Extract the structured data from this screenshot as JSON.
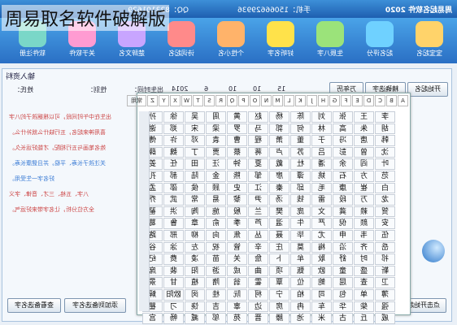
{
  "overlay_title": "周易取名软件破解版",
  "window": {
    "title": "周易起名软件 2020",
    "qq": "QQ：823101629",
    "phone": "手机：15066629936"
  },
  "toolbar": [
    {
      "label": "宝宝起名",
      "icon": "baby-icon"
    },
    {
      "label": "起名评分",
      "icon": "score-icon"
    },
    {
      "label": "生辰八字",
      "icon": "bazi-icon"
    },
    {
      "label": "好听名字",
      "icon": "star-icon"
    },
    {
      "label": "个性小名",
      "icon": "child-icon"
    },
    {
      "label": "诗词起名",
      "icon": "book-icon"
    },
    {
      "label": "楚辞文名",
      "icon": "scroll-icon"
    },
    {
      "label": "关于软件",
      "icon": "info-icon"
    },
    {
      "label": "软件注册",
      "icon": "register-icon"
    }
  ],
  "section_title": "输入资料",
  "controls": {
    "surname_label": "姓氏：",
    "gender_label": "性别：",
    "birth_label": "出生时间：",
    "year": "2014",
    "month": "6",
    "day": "10",
    "hour": "10",
    "minute": "15",
    "start_button": "开始起名",
    "random_button": "精确选字",
    "more_button": "万年历"
  },
  "side_text": [
    "出生在中午时间段，可以根据孩子的八字",
    "喜用神来起名，五行缺什么就补什么。",
    "姓名笔画与五行相配，才能好运长久。",
    "关注孩子长寿、平稳，并且健康长寿。",
    "好名字一生受用。",
    "八字、五格、三才、音律、字义",
    "全方位分析，让名字带来好运气。"
  ],
  "bottom_buttons": {
    "left": "查看备选名字",
    "mid": "添加到备选名字",
    "right": "点击开始起名"
  },
  "watermark": "nongli",
  "letters": [
    "A",
    "B",
    "C",
    "D",
    "E",
    "F",
    "G",
    "H",
    "J",
    "K",
    "L",
    "M",
    "N",
    "O",
    "P",
    "Q",
    "R",
    "S",
    "T",
    "W",
    "X",
    "Y",
    "Z",
    "常用"
  ],
  "chars": [
    "李",
    "王",
    "张",
    "刘",
    "陈",
    "杨",
    "赵",
    "黄",
    "周",
    "吴",
    "徐",
    "孙",
    "胡",
    "朱",
    "高",
    "林",
    "何",
    "郭",
    "马",
    "罗",
    "梁",
    "宋",
    "郑",
    "谢",
    "韩",
    "唐",
    "冯",
    "于",
    "董",
    "萧",
    "程",
    "曹",
    "袁",
    "邓",
    "许",
    "傅",
    "沈",
    "曾",
    "彭",
    "吕",
    "苏",
    "卢",
    "蒋",
    "蔡",
    "贾",
    "丁",
    "魏",
    "薛",
    "叶",
    "阎",
    "余",
    "潘",
    "杜",
    "戴",
    "夏",
    "钟",
    "汪",
    "田",
    "任",
    "姜",
    "范",
    "方",
    "石",
    "姚",
    "谭",
    "廖",
    "邹",
    "熊",
    "金",
    "陆",
    "郝",
    "孔",
    "白",
    "崔",
    "康",
    "毛",
    "邱",
    "秦",
    "江",
    "史",
    "顾",
    "侯",
    "邵",
    "孟",
    "龙",
    "万",
    "段",
    "雷",
    "钱",
    "汤",
    "尹",
    "黎",
    "易",
    "常",
    "武",
    "乔",
    "贺",
    "赖",
    "龚",
    "文",
    "庞",
    "樊",
    "兰",
    "殷",
    "施",
    "陶",
    "洪",
    "翟",
    "安",
    "颜",
    "倪",
    "严",
    "牛",
    "温",
    "芦",
    "季",
    "俞",
    "章",
    "鲁",
    "葛",
    "伍",
    "韦",
    "申",
    "尤",
    "毕",
    "聂",
    "丛",
    "焦",
    "向",
    "柳",
    "邢",
    "路",
    "岳",
    "齐",
    "沿",
    "梅",
    "莫",
    "庄",
    "辛",
    "管",
    "祝",
    "左",
    "涂",
    "谷",
    "祁",
    "时",
    "舒",
    "耿",
    "牟",
    "卜",
    "詹",
    "关",
    "苗",
    "凌",
    "费",
    "纪",
    "靳",
    "盛",
    "童",
    "欧",
    "甄",
    "项",
    "曲",
    "成",
    "游",
    "阳",
    "裴",
    "席",
    "卫",
    "查",
    "屈",
    "鲍",
    "位",
    "覃",
    "霍",
    "翁",
    "隋",
    "植",
    "甘",
    "景",
    "薄",
    "单",
    "包",
    "司",
    "柏",
    "宁",
    "柯",
    "阮",
    "桂",
    "闵",
    "欧阳",
    "解",
    "强",
    "柴",
    "华",
    "车",
    "冉",
    "房",
    "边",
    "辜",
    "吉",
    "饶",
    "刁",
    "瞿",
    "戚",
    "丘",
    "古",
    "米",
    "池",
    "滕",
    "晋",
    "苑",
    "邬",
    "臧",
    "畅",
    "宫"
  ]
}
